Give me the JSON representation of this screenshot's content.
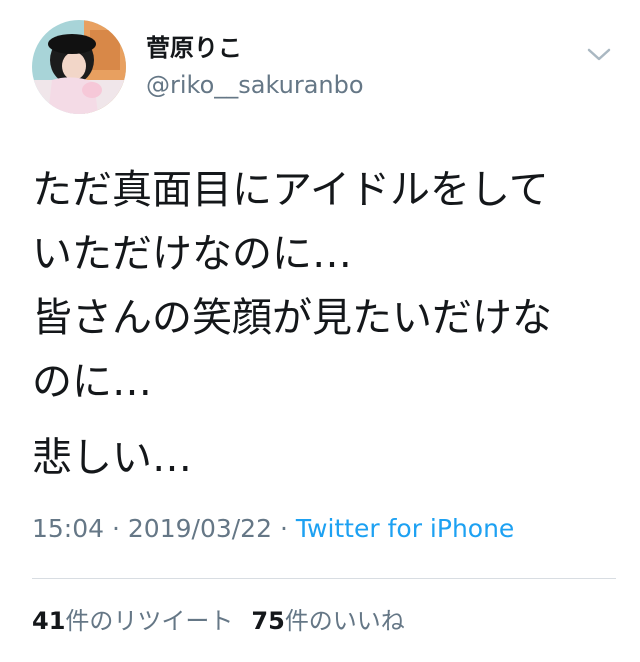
{
  "user": {
    "display_name": "菅原りこ",
    "handle": "@riko__sakuranbo",
    "avatar_icon": "profile-photo"
  },
  "menu": {
    "icon": "chevron-down-icon"
  },
  "tweet": {
    "lines": [
      "ただ真面目にアイドルをして",
      "いただけなのに…",
      "皆さんの笑顔が見たいだけな",
      "のに…"
    ],
    "last_line": "悲しい…"
  },
  "meta": {
    "time": "15:04",
    "date": "2019/03/22",
    "separator": "·",
    "source": "Twitter for iPhone"
  },
  "stats": {
    "retweets_count": "41",
    "retweets_label": "件のリツイート",
    "likes_count": "75",
    "likes_label": "件のいいね"
  },
  "colors": {
    "text": "#14171a",
    "secondary": "#657786",
    "link": "#1da1f2",
    "divider": "#d8dde2"
  }
}
